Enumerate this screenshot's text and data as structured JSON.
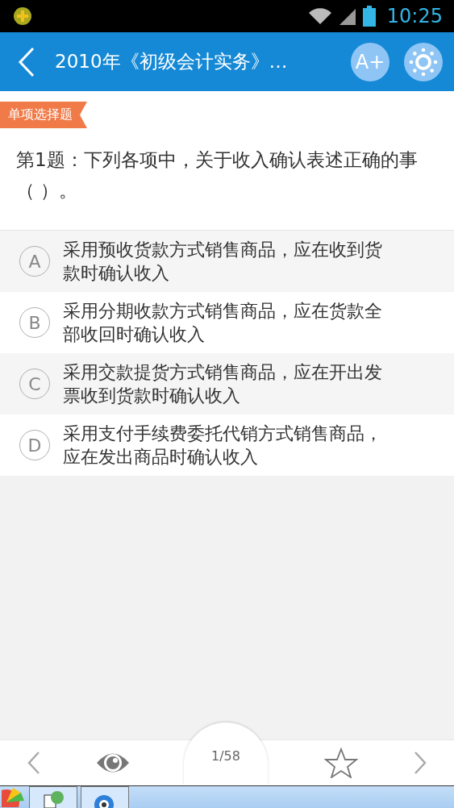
{
  "status_bar": {
    "time": "10:25"
  },
  "app_bar": {
    "title": "2010年《初级会计实务》…",
    "font_button": "A+"
  },
  "question": {
    "type_tag": "单项选择题",
    "text": "第1题：下列各项中，关于收入确认表述正确的事（  ）。"
  },
  "options": [
    {
      "letter": "A",
      "text": "采用预收货款方式销售商品，应在收到货款时确认收入"
    },
    {
      "letter": "B",
      "text": "采用分期收款方式销售商品，应在货款全部收回时确认收入"
    },
    {
      "letter": "C",
      "text": "采用交款提货方式销售商品，应在开出发票收到货款时确认收入"
    },
    {
      "letter": "D",
      "text": "采用支付手续费委托代销方式销售商品，应在发出商品时确认收入"
    }
  ],
  "bottom_nav": {
    "page": "1/58"
  }
}
